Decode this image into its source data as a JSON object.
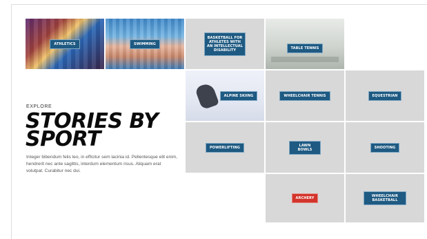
{
  "section": {
    "eyebrow": "EXPLORE",
    "title_line1": "STORIES BY",
    "title_line2": "SPORT",
    "body": "Integer bibendum felis leo, in efficitur sem lacinia id. Pellentesque elit enim, hendrerit nec ante sagittis, interdum elementum risus. Aliquam erat volutpat. Curabitur nec dui."
  },
  "tiles": [
    {
      "label": "ATHLETICS",
      "style": "photo"
    },
    {
      "label": "SWIMMING",
      "style": "photo"
    },
    {
      "label": "BASKETBALL FOR ATHLETES WITH AN INTELLECTUAL DISABILITY",
      "style": "plain"
    },
    {
      "label": "TABLE TENNIS",
      "style": "photo"
    },
    {
      "label": "ALPINE SKIING",
      "style": "photo"
    },
    {
      "label": "WHEELCHAIR TENNIS",
      "style": "plain"
    },
    {
      "label": "EQUESTRIAN",
      "style": "plain"
    },
    {
      "label": "POWERLIFTING",
      "style": "plain"
    },
    {
      "label": "LAWN BOWLS",
      "style": "plain"
    },
    {
      "label": "SHOOTING",
      "style": "plain"
    },
    {
      "label": "ARCHERY",
      "style": "highlighted"
    },
    {
      "label": "WHEELCHAIR BASKETBALL",
      "style": "plain"
    }
  ],
  "colors": {
    "tag_blue": "#1e5a82",
    "tag_red": "#d3342b",
    "tile_grey": "#d8d8d8"
  }
}
